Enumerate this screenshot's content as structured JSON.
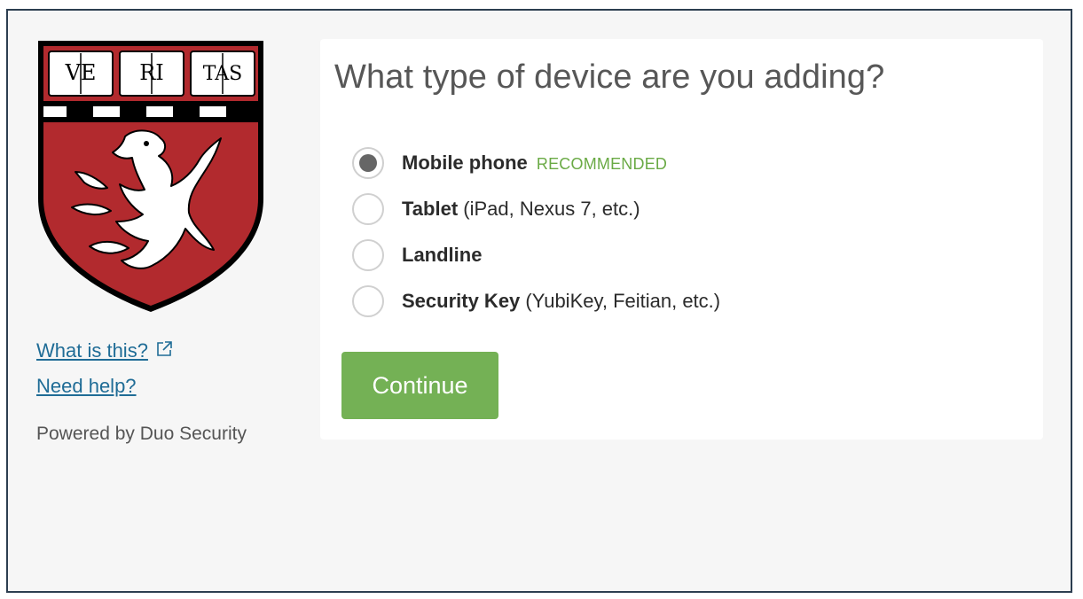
{
  "sidebar": {
    "crest_banners": [
      "VE",
      "RI",
      "TAS"
    ],
    "links": {
      "what_is_this": "What is this?",
      "need_help": "Need help?"
    },
    "powered_by": "Powered by Duo Security"
  },
  "main": {
    "title": "What type of device are you adding?",
    "options": [
      {
        "bold": "Mobile phone",
        "detail": "",
        "badge": "RECOMMENDED",
        "checked": true
      },
      {
        "bold": "Tablet",
        "detail": "(iPad, Nexus 7, etc.)",
        "badge": "",
        "checked": false
      },
      {
        "bold": "Landline",
        "detail": "",
        "badge": "",
        "checked": false
      },
      {
        "bold": "Security Key",
        "detail": "(YubiKey, Feitian, etc.)",
        "badge": "",
        "checked": false
      }
    ],
    "continue_label": "Continue"
  },
  "colors": {
    "accent_green": "#74b155",
    "recommended_green": "#6aaa45",
    "link_blue": "#1f6c96",
    "crest_red": "#b22a2e",
    "frame_border": "#2c3e50"
  }
}
